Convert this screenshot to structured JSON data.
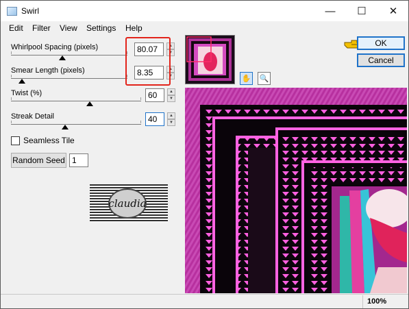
{
  "window": {
    "title": "Swirl"
  },
  "titlebar": {
    "minimize_glyph": "—",
    "maximize_glyph": "☐",
    "close_glyph": "✕"
  },
  "menu": [
    "Edit",
    "Filter",
    "View",
    "Settings",
    "Help"
  ],
  "controls": [
    {
      "label": "Whirlpool Spacing (pixels)",
      "value": "80.07"
    },
    {
      "label": "Smear Length (pixels)",
      "value": "8.35"
    },
    {
      "label": "Twist (%)",
      "value": "60"
    },
    {
      "label": "Streak Detail",
      "value": "40"
    }
  ],
  "seamless_tile": {
    "label": "Seamless Tile",
    "checked": false
  },
  "random_seed": {
    "button_label": "Random Seed",
    "value": "1"
  },
  "buttons": {
    "ok": "OK",
    "cancel": "Cancel"
  },
  "logo": {
    "text": "claudia"
  },
  "status": {
    "zoom": "100%"
  },
  "colors": {
    "accent": "#1e72c9",
    "highlight": "#e2231a",
    "pointer": "#f3c000",
    "preview_magenta": "#c23aab"
  }
}
